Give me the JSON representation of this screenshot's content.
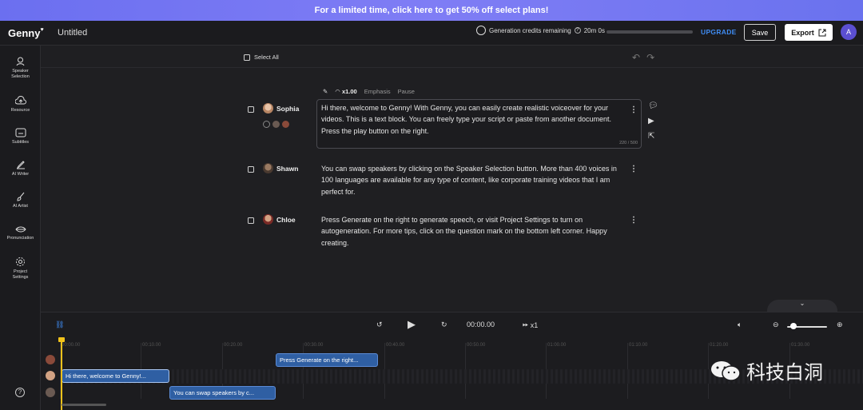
{
  "banner": {
    "text": "For a limited time, click here to get 50% off select plans!"
  },
  "header": {
    "logo": "Genny",
    "title": "Untitled",
    "credits_label": "Generation credits remaining",
    "credits_value": "20m 0s",
    "upgrade": "UPGRADE",
    "save": "Save",
    "export": "Export",
    "avatar_initial": "A"
  },
  "sidebar": {
    "items": [
      {
        "label": "Speaker\nSelection",
        "icon": "speaker-icon"
      },
      {
        "label": "Resource",
        "icon": "upload-cloud-icon"
      },
      {
        "label": "Subtitles",
        "icon": "subtitles-icon"
      },
      {
        "label": "AI Writer",
        "icon": "pen-icon"
      },
      {
        "label": "AI Artist",
        "icon": "brush-icon"
      },
      {
        "label": "Pronunciation",
        "icon": "lips-icon"
      },
      {
        "label": "Project\nSettings",
        "icon": "gear-icon"
      }
    ],
    "help": "?"
  },
  "editor": {
    "select_all": "Select All",
    "toolbar": {
      "speed": "x1.00",
      "emphasis": "Emphasis",
      "pause": "Pause"
    },
    "blocks": [
      {
        "speaker": "Sophia",
        "text": "Hi there, welcome to Genny! With Genny, you can easily create realistic voiceover for your videos. This is a text block. You can freely type your script or paste from another document. Press the play button on the right.",
        "counter": "220 / 500"
      },
      {
        "speaker": "Shawn",
        "text": "You can swap speakers by clicking on the Speaker Selection button. More than 400 voices in 100 languages are available for any type of content, like corporate training videos that I am perfect for."
      },
      {
        "speaker": "Chloe",
        "text": "Press Generate on the right to generate speech, or visit Project Settings to turn on autogeneration. For more tips, click on the question mark on the bottom left corner. Happy creating."
      }
    ]
  },
  "timeline": {
    "time": "00:00.00",
    "speed": "x1",
    "ticks": [
      "00:00.00",
      "00:10.00",
      "00:20.00",
      "00:30.00",
      "00:40.00",
      "00:50.00",
      "01:00.00",
      "01:10.00",
      "01:20.00",
      "01:30.00"
    ],
    "clips": {
      "chloe": "Press Generate on the right...",
      "sophia": "Hi there, welcome to Genny!...",
      "shawn": "You can swap speakers by c..."
    }
  },
  "watermark": "科技白洞",
  "colors": {
    "banner": "#6b6ff0",
    "upgrade": "#3f8cf3",
    "clip": "#2f5fa3",
    "playhead": "#f1c21b"
  }
}
